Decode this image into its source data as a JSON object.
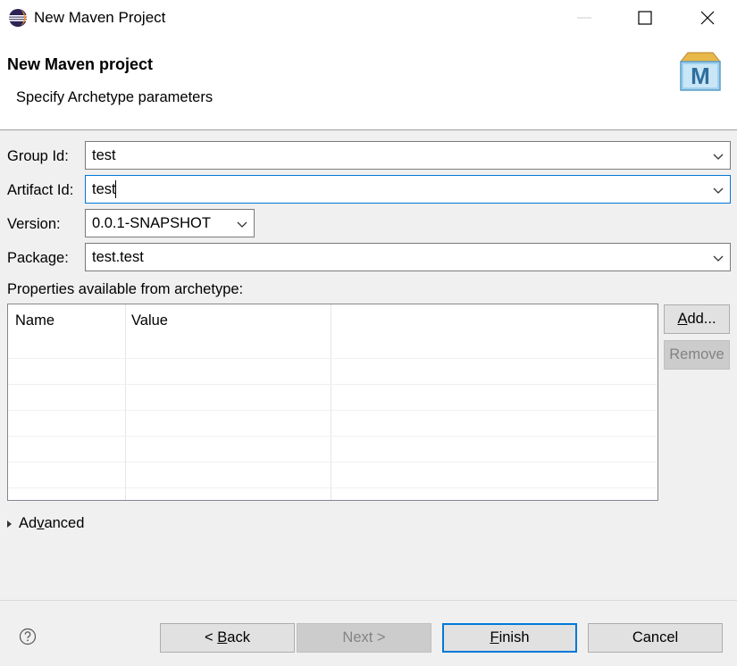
{
  "window": {
    "title": "New Maven Project",
    "icon": "eclipse-icon",
    "controls": [
      "minimize-icon",
      "maximize-icon",
      "close-icon"
    ]
  },
  "header": {
    "title": "New Maven project",
    "subtitle": "Specify Archetype parameters",
    "logo_letter": "M"
  },
  "form": {
    "group_id": {
      "label": "Group Id:",
      "value": "test"
    },
    "artifact_id": {
      "label": "Artifact Id:",
      "value": "test"
    },
    "version": {
      "label": "Version:",
      "value": "0.0.1-SNAPSHOT"
    },
    "package": {
      "label": "Package:",
      "value": "test.test"
    }
  },
  "properties": {
    "label": "Properties available from archetype:",
    "columns": [
      "Name",
      "Value"
    ],
    "rows": []
  },
  "side_buttons": {
    "add": {
      "prefix": "",
      "mnemonic": "A",
      "suffix": "dd..."
    },
    "remove": "Remove"
  },
  "advanced": {
    "prefix": "Ad",
    "mnemonic": "v",
    "suffix": "anced"
  },
  "footer": {
    "help_icon": "help-icon",
    "back": {
      "prefix": "< ",
      "mnemonic": "B",
      "suffix": "ack"
    },
    "next": "Next >",
    "finish": {
      "prefix": "",
      "mnemonic": "F",
      "suffix": "inish"
    },
    "cancel": "Cancel"
  },
  "colors": {
    "accent": "#0078d7",
    "dialog_bg": "#f0f0f0",
    "header_bg": "#ffffff"
  }
}
